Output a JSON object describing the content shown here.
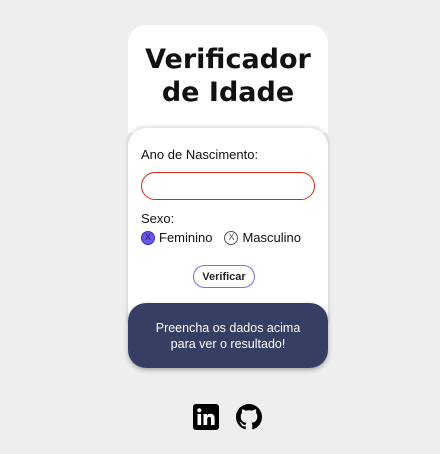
{
  "title": "Verificador de Idade",
  "form": {
    "birth_year_label": "Ano de Nascimento:",
    "birth_year_value": "",
    "sex_label": "Sexo:",
    "options": [
      {
        "label": "Feminino",
        "checked": true
      },
      {
        "label": "Masculino",
        "checked": false
      }
    ],
    "radio_mark": "X",
    "submit_label": "Verificar"
  },
  "result": {
    "message": "Preencha os dados acima para ver o resultado!"
  },
  "social": {
    "icons": [
      "linkedin-icon",
      "github-icon"
    ]
  },
  "colors": {
    "background": "#eeeeee",
    "input_border": "#d42a12",
    "radio_checked": "#6757e6",
    "result_bg": "#363e63"
  }
}
